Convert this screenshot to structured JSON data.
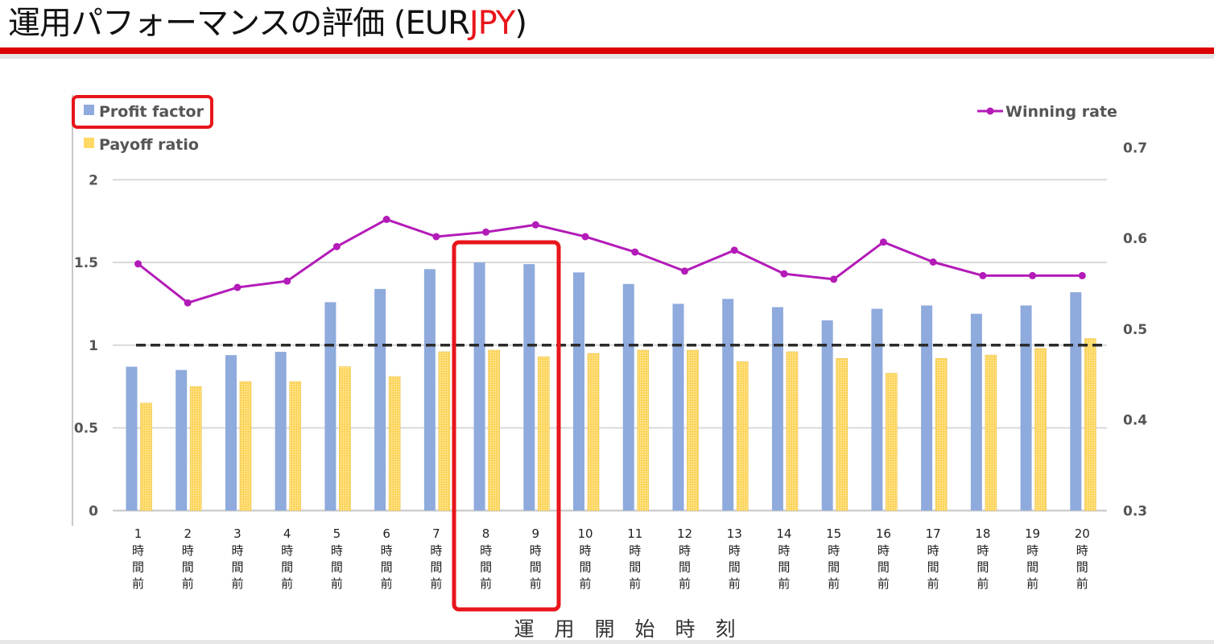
{
  "slide": {
    "title_main": "運用パフォーマンスの評価 (EUR",
    "title_accent": "JPY",
    "title_end": ")",
    "colors": {
      "header_rule": "#dd0000",
      "title_accent": "#e8151b",
      "highlight_box": "#e8151b"
    }
  },
  "chart_data": {
    "type": "bar",
    "title": "",
    "xlabel": "運　用　開　始　時　刻",
    "ylabel": "",
    "y2label": "",
    "categories": [
      "1時間前",
      "2時間前",
      "3時間前",
      "4時間前",
      "5時間前",
      "6時間前",
      "7時間前",
      "8時間前",
      "9時間前",
      "10時間前",
      "11時間前",
      "12時間前",
      "13時間前",
      "14時間前",
      "15時間前",
      "16時間前",
      "17時間前",
      "18時間前",
      "19時間前",
      "20時間前"
    ],
    "category_numbers": [
      "1",
      "2",
      "3",
      "4",
      "5",
      "6",
      "7",
      "8",
      "9",
      "10",
      "11",
      "12",
      "13",
      "14",
      "15",
      "16",
      "17",
      "18",
      "19",
      "20"
    ],
    "category_suffix_chars": [
      "時",
      "間",
      "前"
    ],
    "ylim": [
      0,
      2
    ],
    "yticks": [
      0,
      0.5,
      1,
      1.5,
      2
    ],
    "ytick_labels": [
      "0",
      "0.5",
      "1",
      "1.5",
      "2"
    ],
    "y2lim": [
      0.3,
      0.7
    ],
    "y2ticks": [
      0.3,
      0.4,
      0.5,
      0.6,
      0.7
    ],
    "y2tick_labels": [
      "0.3",
      "0.4",
      "0.5",
      "0.6",
      "0.7"
    ],
    "grid": true,
    "reference_line": {
      "axis": "left",
      "value": 1,
      "style": "dashed",
      "color": "#2b2b2b"
    },
    "series": [
      {
        "name": "Profit factor",
        "type": "bar",
        "axis": "left",
        "color": "#8faadc",
        "values": [
          0.87,
          0.85,
          0.94,
          0.96,
          1.26,
          1.34,
          1.46,
          1.5,
          1.49,
          1.44,
          1.37,
          1.25,
          1.28,
          1.23,
          1.15,
          1.22,
          1.24,
          1.19,
          1.24,
          1.32
        ]
      },
      {
        "name": "Payoff ratio",
        "type": "bar",
        "axis": "left",
        "color": "#ffd966",
        "values": [
          0.65,
          0.75,
          0.78,
          0.78,
          0.87,
          0.81,
          0.96,
          0.97,
          0.93,
          0.95,
          0.97,
          0.97,
          0.9,
          0.96,
          0.92,
          0.83,
          0.92,
          0.94,
          0.98,
          1.04
        ]
      },
      {
        "name": "Winning rate",
        "type": "line",
        "axis": "right",
        "color": "#b31bb8",
        "values": [
          0.572,
          0.529,
          0.546,
          0.553,
          0.591,
          0.621,
          0.602,
          0.607,
          0.615,
          0.602,
          0.585,
          0.564,
          0.587,
          0.561,
          0.555,
          0.596,
          0.574,
          0.559,
          0.559,
          0.559
        ]
      }
    ],
    "legend": [
      {
        "label": "Profit factor",
        "placement": "top-left",
        "highlighted": true
      },
      {
        "label": "Payoff ratio",
        "placement": "top-left",
        "highlighted": false
      },
      {
        "label": "Winning rate",
        "placement": "top-right",
        "highlighted": false
      }
    ],
    "highlighted_categories": [
      "8時間前",
      "9時間前"
    ]
  }
}
